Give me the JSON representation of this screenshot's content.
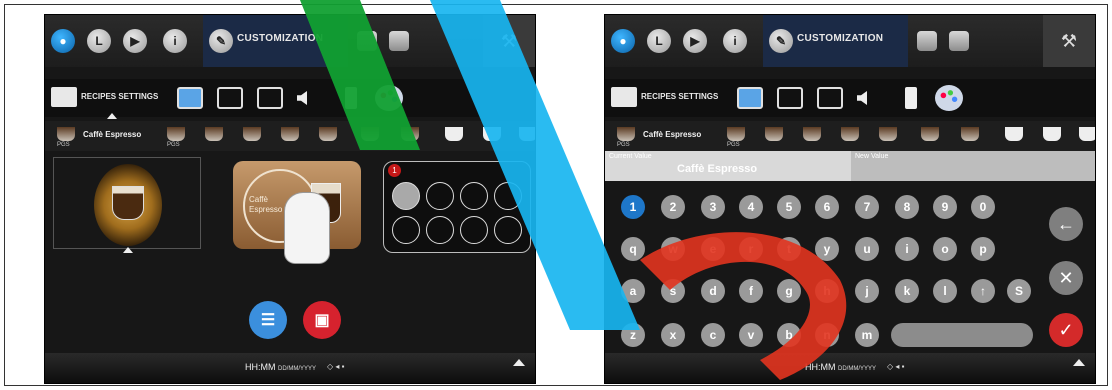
{
  "left": {
    "toolbar_label": "CUSTOMIZATION",
    "tabs_label": "RECIPES SETTINGS",
    "strip": {
      "selected": "Caffè Espresso",
      "pgs1": "PGS",
      "pgs2": "PGS"
    },
    "button_text_line1": "Caffè",
    "button_text_line2": "Espresso",
    "slot_badge": "1",
    "clock": "HH:MM",
    "date": "DD/MM/YYYY"
  },
  "right": {
    "toolbar_label": "CUSTOMIZATION",
    "tabs_label": "RECIPES SETTINGS",
    "strip": {
      "selected": "Caffè Espresso",
      "pgs1": "PGS",
      "pgs2": "PGS"
    },
    "current_value_label": "Current Value",
    "new_value_label": "New Value",
    "current_value": "Caffè Espresso",
    "clock": "HH:MM",
    "date": "DD/MM/YYYY",
    "keys_row1": [
      "1",
      "2",
      "3",
      "4",
      "5",
      "6",
      "7",
      "8",
      "9",
      "0"
    ],
    "keys_row2": [
      "q",
      "w",
      "e",
      "r",
      "t",
      "y",
      "u",
      "i",
      "o",
      "p"
    ],
    "keys_row3": [
      "a",
      "s",
      "d",
      "f",
      "g",
      "h",
      "j",
      "k",
      "l",
      "↑",
      "S"
    ],
    "keys_row4": [
      "z",
      "x",
      "c",
      "v",
      "b",
      "n",
      "m"
    ],
    "backspace": "←",
    "cancel": "✕",
    "confirm": "✓"
  },
  "icons": {
    "wrench": "🔧"
  }
}
